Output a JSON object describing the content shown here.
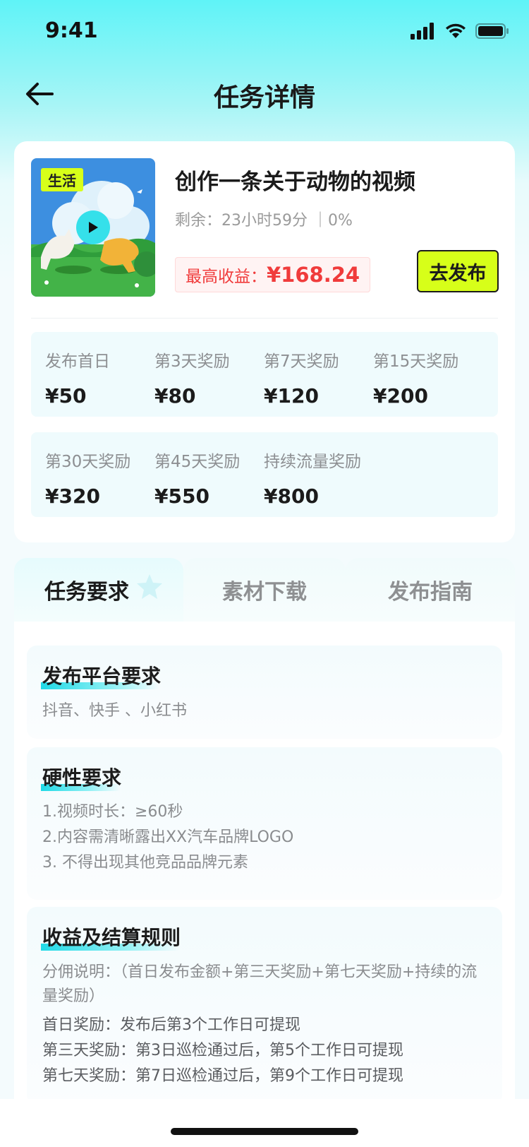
{
  "status_bar": {
    "time": "9:41"
  },
  "nav": {
    "title": "任务详情"
  },
  "task": {
    "category": "生活",
    "title": "创作一条关于动物的视频",
    "remaining": "剩余：23小时59分 ｜0%",
    "earnings_label": "最高收益：",
    "earnings_value": "¥168.24",
    "publish_label": "去发布"
  },
  "rewards_row1": [
    {
      "label": "发布首日",
      "value": "¥50"
    },
    {
      "label": "第3天奖励",
      "value": "¥80"
    },
    {
      "label": "第7天奖励",
      "value": "¥120"
    },
    {
      "label": "第15天奖励",
      "value": "¥200"
    }
  ],
  "rewards_row2": [
    {
      "label": "第30天奖励",
      "value": "¥320"
    },
    {
      "label": "第45天奖励",
      "value": "¥550"
    },
    {
      "label": "持续流量奖励",
      "value": "¥800"
    }
  ],
  "tabs": [
    "任务要求",
    "素材下载",
    "发布指南"
  ],
  "sections": {
    "platform": {
      "title": "发布平台要求",
      "text": "抖音、快手 、小红书"
    },
    "hard": {
      "title": "硬性要求",
      "items": [
        "1.视频时长：≥60秒",
        "2.内容需清晰露出XX汽车品牌LOGO",
        "3. 不得出现其他竞品品牌元素"
      ]
    },
    "settlement": {
      "title": "收益及结算规则",
      "desc": "分佣说明：（首日发布金额+第三天奖励+第七天奖励+持续的流量奖励）",
      "items": [
        "首日奖励：发布后第3个工作日可提现",
        "第三天奖励：第3日巡检通过后，第5个工作日可提现",
        "第七天奖励：第7日巡检通过后，第9个工作日可提现"
      ]
    }
  },
  "colors": {
    "accent": "#d7ff19",
    "earnings": "#f03b3b",
    "cyan": "#20d9e6"
  }
}
